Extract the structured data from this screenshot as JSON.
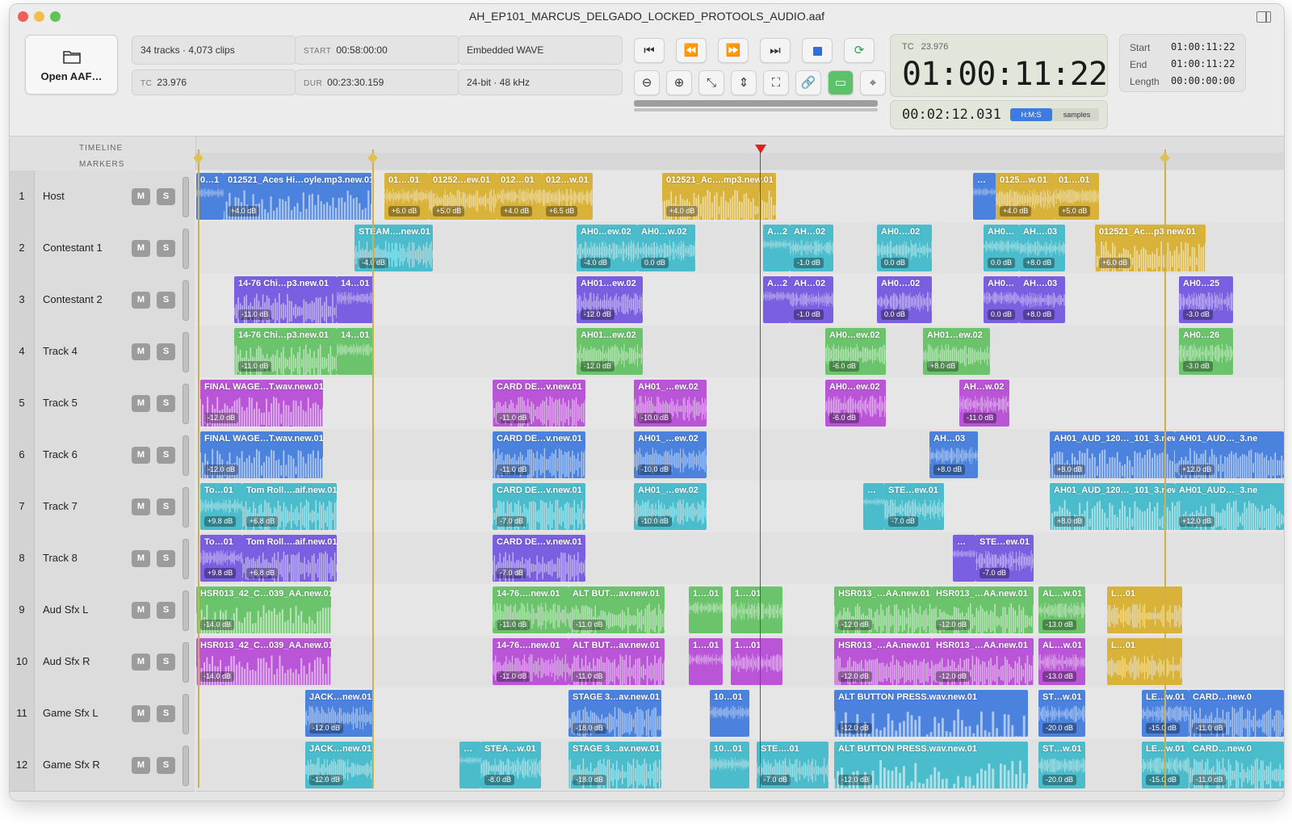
{
  "window": {
    "title": "AH_EP101_MARCUS_DELGADO_LOCKED_PROTOOLS_AUDIO.aaf"
  },
  "toolbar": {
    "open_label": "Open AAF…",
    "tracks_clips": "34 tracks · 4,073 clips",
    "tc_label": "TC",
    "tc_value": "23.976",
    "start_label": "START",
    "start_value": "00:58:00:00",
    "dur_label": "DUR",
    "dur_value": "00:23:30.159",
    "media_type": "Embedded WAVE",
    "audio_format": "24-bit · 48 kHz"
  },
  "timecode": {
    "tc_label": "TC",
    "fps": "23.976",
    "main": "01:00:11:22",
    "elapsed": "00:02:12.031",
    "mode_active": "H:M:S",
    "mode_inactive": "samples"
  },
  "selection": {
    "start_label": "Start",
    "start_value": "01:00:11:22",
    "end_label": "End",
    "end_value": "01:00:11:22",
    "length_label": "Length",
    "length_value": "00:00:00:00"
  },
  "ruler": {
    "timeline_label": "TIMELINE",
    "markers_label": "MARKERS"
  },
  "colors": {
    "blue": "#4a82de",
    "yellow": "#d9b23a",
    "cyan": "#4bbccb",
    "purple": "#7a5fe0",
    "green": "#6bc46b",
    "magenta": "#b955d6"
  },
  "buttons": {
    "mute": "M",
    "solo": "S"
  },
  "tracks": [
    {
      "num": "1",
      "name": "Host",
      "clips": [
        {
          "name": "0…1",
          "gain": "",
          "color": "blue"
        },
        {
          "name": "012521_Aces Hi…oyle.mp3.new.01",
          "gain": "+4.0 dB",
          "color": "blue"
        },
        {
          "name": "01….01",
          "gain": "+6.0 dB",
          "color": "yellow"
        },
        {
          "name": "01252…ew.01",
          "gain": "+5.0 dB",
          "color": "yellow"
        },
        {
          "name": "012…01",
          "gain": "+4.0 dB",
          "color": "yellow"
        },
        {
          "name": "012…w.01",
          "gain": "+6.5 dB",
          "color": "yellow"
        },
        {
          "name": "012521_Ac….mp3.new.01",
          "gain": "+4.0 dB",
          "color": "yellow"
        },
        {
          "name": "…",
          "gain": "",
          "color": "blue"
        },
        {
          "name": "0125…w.01",
          "gain": "+4.0 dB",
          "color": "yellow"
        },
        {
          "name": "01….01",
          "gain": "+5.0 dB",
          "color": "yellow"
        }
      ]
    },
    {
      "num": "2",
      "name": "Contestant 1",
      "clips": [
        {
          "name": "STEAM….new.01",
          "gain": "-4.0 dB",
          "color": "cyan"
        },
        {
          "name": "AH0…ew.02",
          "gain": "-4.0 dB",
          "color": "cyan"
        },
        {
          "name": "AH0…w.02",
          "gain": "0.0 dB",
          "color": "cyan"
        },
        {
          "name": "A…2",
          "gain": "",
          "color": "cyan"
        },
        {
          "name": "AH…02",
          "gain": "-1.0 dB",
          "color": "cyan"
        },
        {
          "name": "AH0….02",
          "gain": "0.0 dB",
          "color": "cyan"
        },
        {
          "name": "AH0…",
          "gain": "0.0 dB",
          "color": "cyan"
        },
        {
          "name": "AH….03",
          "gain": "+8.0 dB",
          "color": "cyan"
        },
        {
          "name": "012521_Ac…p3.new.01",
          "gain": "+6.0 dB",
          "color": "yellow"
        }
      ]
    },
    {
      "num": "3",
      "name": "Contestant 2",
      "clips": [
        {
          "name": "14-76 Chi…p3.new.01",
          "gain": "-11.0 dB",
          "color": "purple"
        },
        {
          "name": "14…01",
          "gain": "",
          "color": "purple"
        },
        {
          "name": "AH01…ew.02",
          "gain": "-12.0 dB",
          "color": "purple"
        },
        {
          "name": "A…2",
          "gain": "",
          "color": "purple"
        },
        {
          "name": "AH…02",
          "gain": "-1.0 dB",
          "color": "purple"
        },
        {
          "name": "AH0….02",
          "gain": "0.0 dB",
          "color": "purple"
        },
        {
          "name": "AH0…",
          "gain": "0.0 dB",
          "color": "purple"
        },
        {
          "name": "AH….03",
          "gain": "+8.0 dB",
          "color": "purple"
        },
        {
          "name": "AH0…25",
          "gain": "-3.0 dB",
          "color": "purple"
        }
      ]
    },
    {
      "num": "4",
      "name": "Track 4",
      "clips": [
        {
          "name": "14-76 Chi…p3.new.01",
          "gain": "-11.0 dB",
          "color": "green"
        },
        {
          "name": "14…01",
          "gain": "",
          "color": "green"
        },
        {
          "name": "AH01…ew.02",
          "gain": "-12.0 dB",
          "color": "green"
        },
        {
          "name": "AH0…ew.02",
          "gain": "-6.0 dB",
          "color": "green"
        },
        {
          "name": "AH01…ew.02",
          "gain": "+8.0 dB",
          "color": "green"
        },
        {
          "name": "AH0…26",
          "gain": "-3.0 dB",
          "color": "green"
        }
      ]
    },
    {
      "num": "5",
      "name": "Track 5",
      "clips": [
        {
          "name": "FINAL WAGE…T.wav.new.01",
          "gain": "-12.0 dB",
          "color": "magenta"
        },
        {
          "name": "CARD DE…v.new.01",
          "gain": "-11.0 dB",
          "color": "magenta"
        },
        {
          "name": "AH01_…ew.02",
          "gain": "-10.0 dB",
          "color": "magenta"
        },
        {
          "name": "AH0…ew.02",
          "gain": "-6.0 dB",
          "color": "magenta"
        },
        {
          "name": "AH…w.02",
          "gain": "-11.0 dB",
          "color": "magenta"
        }
      ]
    },
    {
      "num": "6",
      "name": "Track 6",
      "clips": [
        {
          "name": "FINAL WAGE…T.wav.new.01",
          "gain": "-12.0 dB",
          "color": "blue"
        },
        {
          "name": "CARD DE…v.new.01",
          "gain": "-11.0 dB",
          "color": "blue"
        },
        {
          "name": "AH01_…ew.02",
          "gain": "-10.0 dB",
          "color": "blue"
        },
        {
          "name": "AH…03",
          "gain": "+8.0 dB",
          "color": "blue"
        },
        {
          "name": "AH01_AUD_120…_101_3.new.",
          "gain": "+8.0 dB",
          "color": "blue"
        },
        {
          "name": "AH01_AUD…_3.ne",
          "gain": "+12.0 dB",
          "color": "blue"
        }
      ]
    },
    {
      "num": "7",
      "name": "Track 7",
      "clips": [
        {
          "name": "To…01",
          "gain": "+9.8 dB",
          "color": "cyan"
        },
        {
          "name": "Tom Roll….aif.new.01",
          "gain": "+6.8 dB",
          "color": "cyan"
        },
        {
          "name": "CARD DE…v.new.01",
          "gain": "-7.0 dB",
          "color": "cyan"
        },
        {
          "name": "AH01_…ew.02",
          "gain": "-10.0 dB",
          "color": "cyan"
        },
        {
          "name": "…",
          "gain": "",
          "color": "cyan"
        },
        {
          "name": "STE…ew.01",
          "gain": "-7.0 dB",
          "color": "cyan"
        },
        {
          "name": "AH01_AUD_120…_101_3.new.",
          "gain": "+8.0 dB",
          "color": "cyan"
        },
        {
          "name": "AH01_AUD…_3.ne",
          "gain": "+12.0 dB",
          "color": "cyan"
        }
      ]
    },
    {
      "num": "8",
      "name": "Track 8",
      "clips": [
        {
          "name": "To…01",
          "gain": "+9.8 dB",
          "color": "purple"
        },
        {
          "name": "Tom Roll….aif.new.01",
          "gain": "+6.8 dB",
          "color": "purple"
        },
        {
          "name": "CARD DE…v.new.01",
          "gain": "-7.0 dB",
          "color": "purple"
        },
        {
          "name": "…",
          "gain": "",
          "color": "purple"
        },
        {
          "name": "STE…ew.01",
          "gain": "-7.0 dB",
          "color": "purple"
        }
      ]
    },
    {
      "num": "9",
      "name": "Aud Sfx L",
      "clips": [
        {
          "name": "HSR013_42_C…039_AA.new.01",
          "gain": "-14.0 dB",
          "color": "green"
        },
        {
          "name": "14-76….new.01",
          "gain": "-11.0 dB",
          "color": "green"
        },
        {
          "name": "ALT BUT…av.new.01",
          "gain": "-11.0 dB",
          "color": "green"
        },
        {
          "name": "1….01",
          "gain": "",
          "color": "green"
        },
        {
          "name": "1….01",
          "gain": "",
          "color": "green"
        },
        {
          "name": "HSR013_…AA.new.01",
          "gain": "-12.0 dB",
          "color": "green"
        },
        {
          "name": "HSR013_…AA.new.01",
          "gain": "-12.0 dB",
          "color": "green"
        },
        {
          "name": "AL…w.01",
          "gain": "-13.0 dB",
          "color": "green"
        },
        {
          "name": "L…01",
          "gain": "",
          "color": "yellow"
        }
      ]
    },
    {
      "num": "10",
      "name": "Aud Sfx R",
      "clips": [
        {
          "name": "HSR013_42_C…039_AA.new.01",
          "gain": "-14.0 dB",
          "color": "magenta"
        },
        {
          "name": "14-76….new.01",
          "gain": "-11.0 dB",
          "color": "magenta"
        },
        {
          "name": "ALT BUT…av.new.01",
          "gain": "-11.0 dB",
          "color": "magenta"
        },
        {
          "name": "1….01",
          "gain": "",
          "color": "magenta"
        },
        {
          "name": "1….01",
          "gain": "",
          "color": "magenta"
        },
        {
          "name": "HSR013_…AA.new.01",
          "gain": "-12.0 dB",
          "color": "magenta"
        },
        {
          "name": "HSR013_…AA.new.01",
          "gain": "-12.0 dB",
          "color": "magenta"
        },
        {
          "name": "AL…w.01",
          "gain": "-13.0 dB",
          "color": "magenta"
        },
        {
          "name": "L…01",
          "gain": "",
          "color": "yellow"
        }
      ]
    },
    {
      "num": "11",
      "name": "Game Sfx L",
      "clips": [
        {
          "name": "JACK…new.01",
          "gain": "-12.0 dB",
          "color": "blue"
        },
        {
          "name": "STAGE 3…av.new.01",
          "gain": "-18.0 dB",
          "color": "blue"
        },
        {
          "name": "10…01",
          "gain": "",
          "color": "blue"
        },
        {
          "name": "ALT BUTTON PRESS.wav.new.01",
          "gain": "-12.0 dB",
          "color": "blue"
        },
        {
          "name": "ST…w.01",
          "gain": "-20.0 dB",
          "color": "blue"
        },
        {
          "name": "LE…w.01",
          "gain": "-15.0 dB",
          "color": "blue"
        },
        {
          "name": "CARD…new.0",
          "gain": "-11.0 dB",
          "color": "blue"
        }
      ]
    },
    {
      "num": "12",
      "name": "Game Sfx R",
      "clips": [
        {
          "name": "JACK…new.01",
          "gain": "-12.0 dB",
          "color": "cyan"
        },
        {
          "name": "…",
          "gain": "",
          "color": "cyan"
        },
        {
          "name": "STEA…w.01",
          "gain": "-8.0 dB",
          "color": "cyan"
        },
        {
          "name": "STAGE 3…av.new.01",
          "gain": "-18.0 dB",
          "color": "cyan"
        },
        {
          "name": "10…01",
          "gain": "",
          "color": "cyan"
        },
        {
          "name": "STE….01",
          "gain": "-7.0 dB",
          "color": "cyan"
        },
        {
          "name": "ALT BUTTON PRESS.wav.new.01",
          "gain": "-12.0 dB",
          "color": "cyan"
        },
        {
          "name": "ST…w.01",
          "gain": "-20.0 dB",
          "color": "cyan"
        },
        {
          "name": "LE…w.01",
          "gain": "-15.0 dB",
          "color": "cyan"
        },
        {
          "name": "CARD…new.0",
          "gain": "-11.0 dB",
          "color": "cyan"
        }
      ]
    }
  ]
}
